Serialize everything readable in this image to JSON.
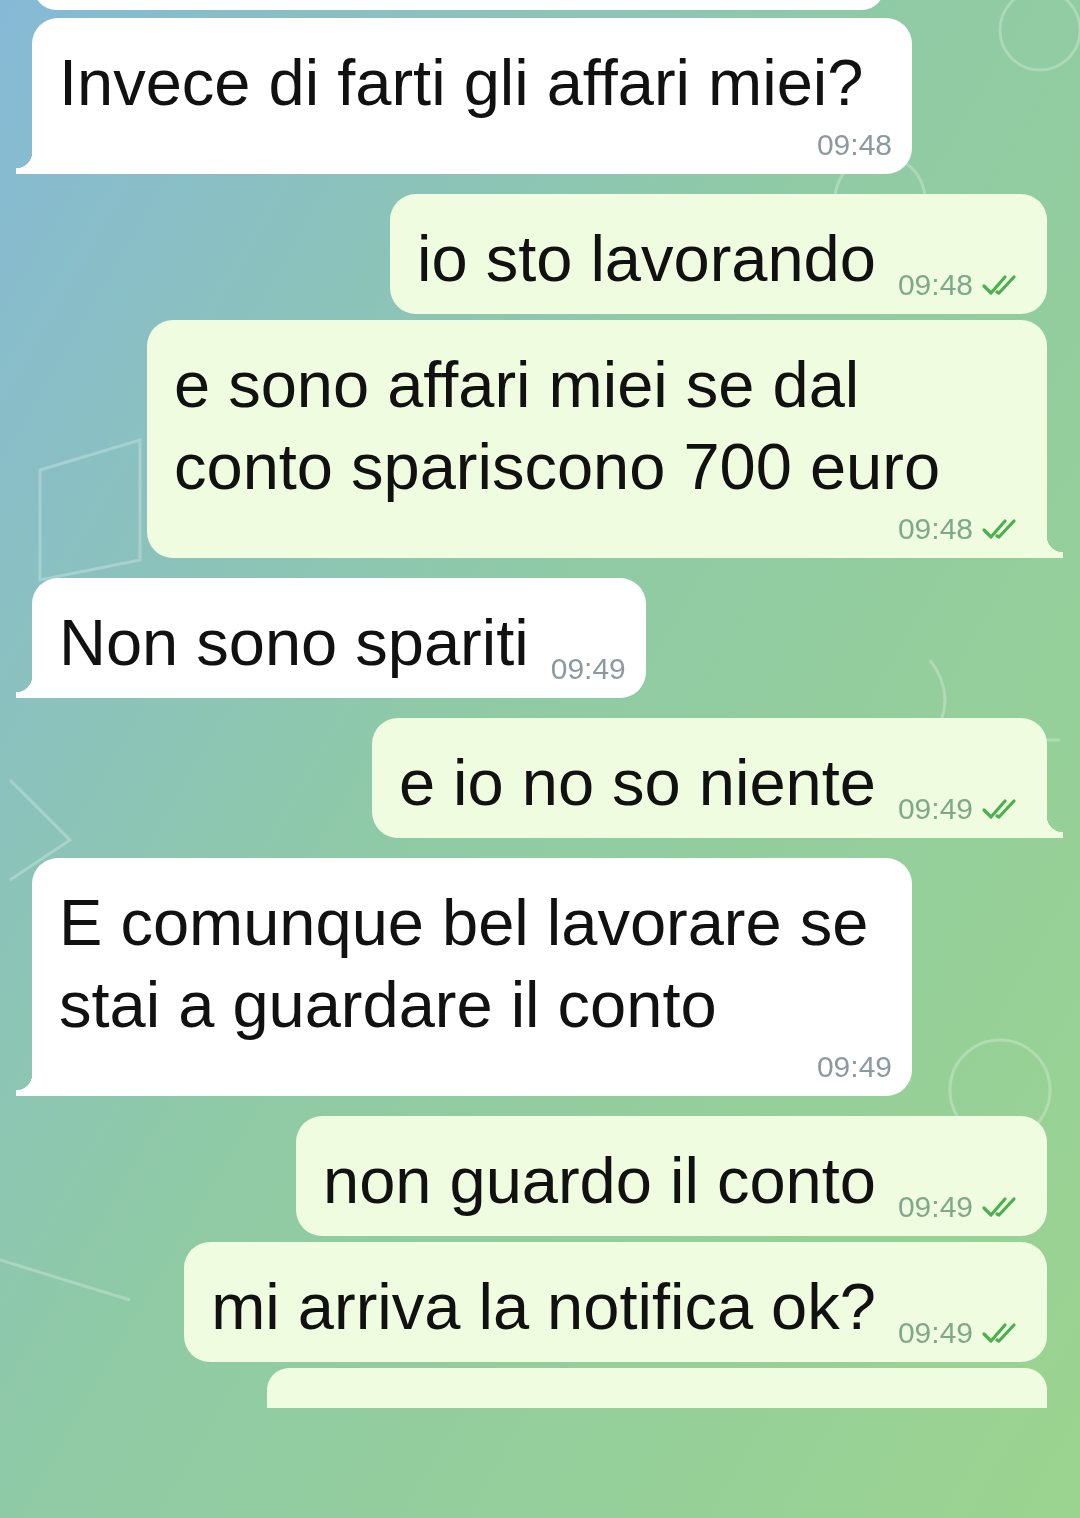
{
  "messages": [
    {
      "kind": "incoming",
      "text": "Invece di farti gli affari miei?",
      "time": "09:48",
      "tail": true
    },
    {
      "kind": "outgoing",
      "text": "io sto lavorando",
      "time": "09:48",
      "tail": false,
      "read": true
    },
    {
      "kind": "outgoing",
      "text": "e sono affari miei se dal conto spariscono 700 euro",
      "time": "09:48",
      "tail": true,
      "read": true
    },
    {
      "kind": "incoming",
      "text": "Non sono spariti",
      "time": "09:49",
      "tail": true
    },
    {
      "kind": "outgoing",
      "text": "e io no so niente",
      "time": "09:49",
      "tail": true,
      "read": true
    },
    {
      "kind": "incoming",
      "text": "E comunque bel lavorare se stai a guardare il conto",
      "time": "09:49",
      "tail": true
    },
    {
      "kind": "outgoing",
      "text": "non guardo il conto",
      "time": "09:49",
      "tail": false,
      "read": true
    },
    {
      "kind": "outgoing",
      "text": "mi arriva la notifica ok?",
      "time": "09:49",
      "tail": false,
      "read": true
    }
  ]
}
